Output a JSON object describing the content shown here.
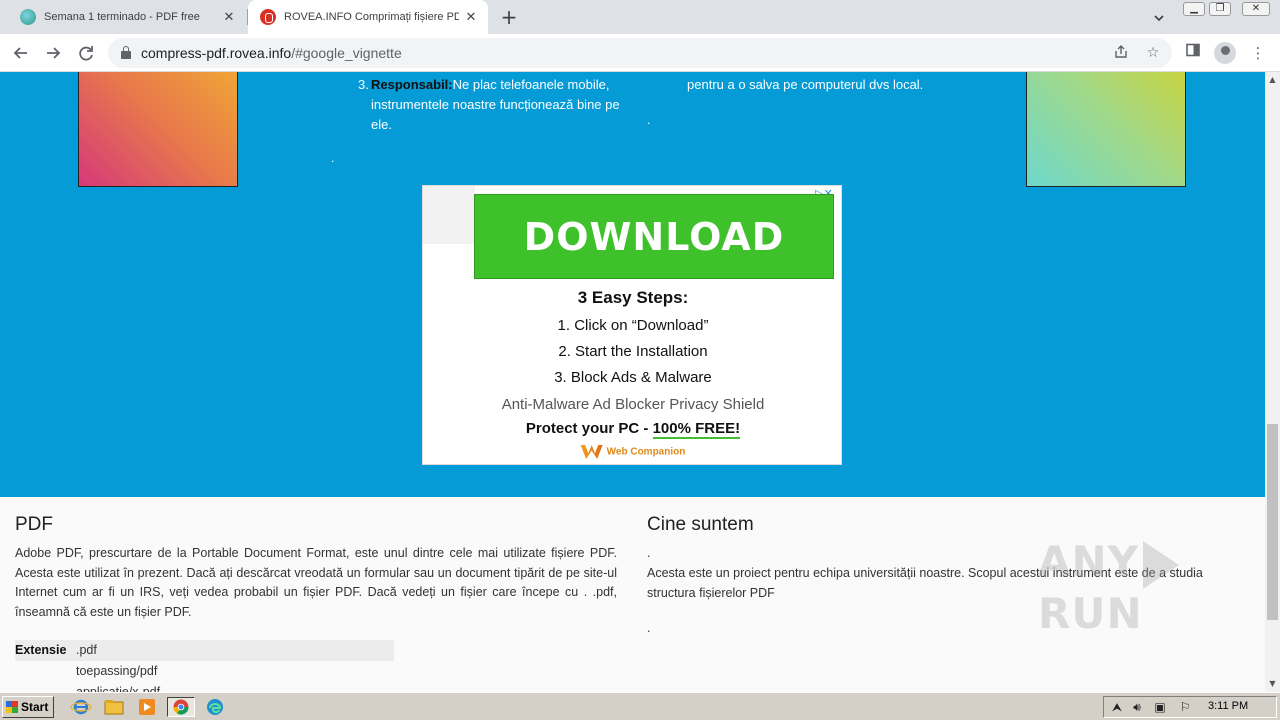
{
  "browser": {
    "tabs": [
      {
        "title": "Semana 1 terminado - PDF free",
        "active": false
      },
      {
        "title": "ROVEA.INFO Comprimați fișiere PDF",
        "active": true
      }
    ],
    "new_tab_symbol": "+",
    "url_domain": "compress-pdf.rovea.info",
    "url_path": "/#google_vignette",
    "icons": [
      "back-icon",
      "forward-icon",
      "reload-icon",
      "lock-icon",
      "share-icon",
      "star-icon",
      "sidepanel-icon",
      "profile-icon",
      "menu-icon"
    ]
  },
  "features": {
    "item3_number": "3.",
    "item3_bold": "Responsabil:",
    "item3_text": "Ne plac telefoanele mobile, instrumentele noastre funcționează bine pe ele.",
    "right_text": "pentru a o salva pe computerul dvs local.",
    "dot": "."
  },
  "ad": {
    "button_label": "DOWNLOAD",
    "steps_title": "3 Easy Steps:",
    "steps": [
      "1. Click on “Download”",
      "2. Start the Installation",
      "3. Block Ads & Malware"
    ],
    "tagline": "Anti-Malware Ad Blocker Privacy Shield",
    "protect_prefix": "Protect your PC - ",
    "protect_free": "100% FREE!",
    "brand": "Web Companion",
    "adchoices_icon": "▷✕"
  },
  "pdf_section": {
    "title": "PDF",
    "body": "Adobe PDF, prescurtare de la Portable Document Format, este unul dintre cele mai utilizate fișiere PDF. Acesta este utilizat în prezent. Dacă ați descărcat vreodată un formular sau un document tipărit de pe site-ul Internet cum ar fi un IRS, veți vedea probabil un fișier PDF. Dacă vedeți un fișier care începe cu . .pdf, înseamnă că este un fișier PDF.",
    "table": {
      "key": "Extensie",
      "value": ".pdf",
      "more": [
        "toepassing/pdf",
        "applicatie/x-pdf"
      ]
    }
  },
  "about_section": {
    "title": "Cine suntem",
    "dot": ".",
    "body": "Acesta este un proiect pentru echipa universității noastre. Scopul acestui instrument este de a studia structura fișierelor PDF",
    "trailing": "."
  },
  "watermark": {
    "left": "ANY",
    "right": "RUN"
  },
  "taskbar": {
    "start_label": "Start",
    "clock": "3:11 PM"
  }
}
